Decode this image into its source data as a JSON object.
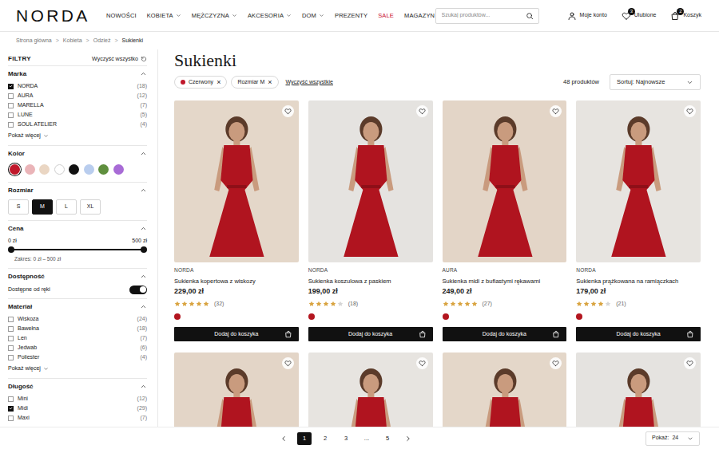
{
  "header": {
    "logo": "NORDA",
    "nav": [
      {
        "label": "NOWOŚCI",
        "dropdown": false,
        "highlighted": false
      },
      {
        "label": "KOBIETA",
        "dropdown": true,
        "highlighted": false
      },
      {
        "label": "MĘŻCZYZNA",
        "dropdown": true,
        "highlighted": false
      },
      {
        "label": "AKCESORIA",
        "dropdown": true,
        "highlighted": false
      },
      {
        "label": "DOM",
        "dropdown": true,
        "highlighted": false
      },
      {
        "label": "PREZENTY",
        "dropdown": false,
        "highlighted": false
      },
      {
        "label": "SALE",
        "dropdown": false,
        "highlighted": true
      },
      {
        "label": "MAGAZYN",
        "dropdown": false,
        "highlighted": false
      }
    ],
    "search": {
      "placeholder": "Szukaj produktów..."
    },
    "account": {
      "label": "Moje konto"
    },
    "favorites": {
      "label": "Ulubione",
      "badge": "3"
    },
    "cart": {
      "label": "Koszyk",
      "badge": "2"
    }
  },
  "breadcrumb": {
    "separator": ">",
    "items": [
      {
        "label": "Strona główna",
        "current": false
      },
      {
        "label": "Kobieta",
        "current": false
      },
      {
        "label": "Odzież",
        "current": false
      },
      {
        "label": "Sukienki",
        "current": true
      }
    ]
  },
  "filters": {
    "title": "FILTRY",
    "clear_all": "Wyczyść wszystko",
    "sections": [
      {
        "kind": "checkboxes",
        "title": "Marka",
        "expanded": true,
        "more": "Pokaż więcej",
        "items": [
          {
            "label": "NORDA",
            "count": "(18)",
            "checked": true
          },
          {
            "label": "AURA",
            "count": "(12)",
            "checked": false
          },
          {
            "label": "MARELLA",
            "count": "(7)",
            "checked": false
          },
          {
            "label": "LUNE",
            "count": "(5)",
            "checked": false
          },
          {
            "label": "SOUL ATELIER",
            "count": "(4)",
            "checked": false
          }
        ]
      },
      {
        "kind": "swatches",
        "title": "Kolor",
        "expanded": true,
        "items": [
          {
            "color": "#c0182b",
            "selected": true
          },
          {
            "color": "#eab4b8",
            "selected": false
          },
          {
            "color": "#ead6c3",
            "selected": false
          },
          {
            "color": "#ffffff",
            "selected": false
          },
          {
            "color": "#111111",
            "selected": false
          },
          {
            "color": "#b9cdee",
            "selected": false
          },
          {
            "color": "#5f8f3e",
            "selected": false
          },
          {
            "color": "#a86bd6",
            "selected": false
          }
        ]
      },
      {
        "kind": "sizes",
        "title": "Rozmiar",
        "expanded": true,
        "items": [
          {
            "label": "S",
            "selected": false
          },
          {
            "label": "M",
            "selected": true
          },
          {
            "label": "L",
            "selected": false
          },
          {
            "label": "XL",
            "selected": false
          }
        ]
      },
      {
        "kind": "range",
        "title": "Cena",
        "expanded": true,
        "min": "0 zł",
        "max": "500 zł",
        "summary": "Zakres: 0 zł – 500 zł",
        "level": 1
      },
      {
        "kind": "toggle",
        "title": "Dostępność",
        "expanded": true,
        "label": "Dostępne od ręki",
        "on": true
      },
      {
        "kind": "checkboxes",
        "title": "Materiał",
        "expanded": true,
        "more": "Pokaż więcej",
        "items": [
          {
            "label": "Wiskoza",
            "count": "(24)",
            "checked": false
          },
          {
            "label": "Bawełna",
            "count": "(18)",
            "checked": false
          },
          {
            "label": "Len",
            "count": "(7)",
            "checked": false
          },
          {
            "label": "Jedwab",
            "count": "(6)",
            "checked": false
          },
          {
            "label": "Poliester",
            "count": "(4)",
            "checked": false
          }
        ]
      },
      {
        "kind": "checkboxes",
        "title": "Długość",
        "expanded": true,
        "items": [
          {
            "label": "Mini",
            "count": "(12)",
            "checked": false
          },
          {
            "label": "Midi",
            "count": "(29)",
            "checked": true
          },
          {
            "label": "Maxi",
            "count": "(7)",
            "checked": false
          }
        ]
      }
    ]
  },
  "listing": {
    "title": "Sukienki",
    "active_filters": [
      {
        "label": "Czerwony",
        "remove": "×",
        "color": "#c0182b"
      },
      {
        "label": "Rozmiar M",
        "remove": "×"
      }
    ],
    "clear_filters": "Wyczyść wszystkie",
    "count": "48 produktów",
    "sort": {
      "label": "Sortuj: Najnowsze"
    },
    "products": [
      {
        "brand": "NORDA",
        "name": "Sukienka kopertowa z wiskozy",
        "price": "229,00 zł",
        "stars": 5,
        "reviews": "(32)",
        "color": "#b3161f",
        "favorite": false,
        "button": "Dodaj do koszyka"
      },
      {
        "brand": "NORDA",
        "name": "Sukienka koszulowa z paskiem",
        "price": "199,00 zł",
        "stars": 4,
        "reviews": "(18)",
        "color": "#b3161f",
        "favorite": false,
        "button": "Dodaj do koszyka"
      },
      {
        "brand": "AURA",
        "name": "Sukienka midi z bufiastymi rękawami",
        "price": "249,00 zł",
        "stars": 5,
        "reviews": "(27)",
        "color": "#b3161f",
        "favorite": false,
        "button": "Dodaj do koszyka"
      },
      {
        "brand": "NORDA",
        "name": "Sukienka prążkowana na ramiączkach",
        "price": "179,00 zł",
        "stars": 4,
        "reviews": "(21)",
        "color": "#b3161f",
        "favorite": false,
        "button": "Dodaj do koszyka"
      }
    ],
    "more_products": [
      {
        "favorite": false
      },
      {
        "favorite": false
      },
      {
        "favorite": false
      },
      {
        "favorite": false
      }
    ]
  },
  "pagination": {
    "pages": [
      {
        "label": "1",
        "selected": true
      },
      {
        "label": "2",
        "selected": false
      },
      {
        "label": "3",
        "selected": false
      },
      {
        "label": "...",
        "selected": false
      },
      {
        "label": "5",
        "selected": false
      }
    ]
  },
  "page_size": {
    "label": "Pokaż:",
    "value": "24"
  }
}
